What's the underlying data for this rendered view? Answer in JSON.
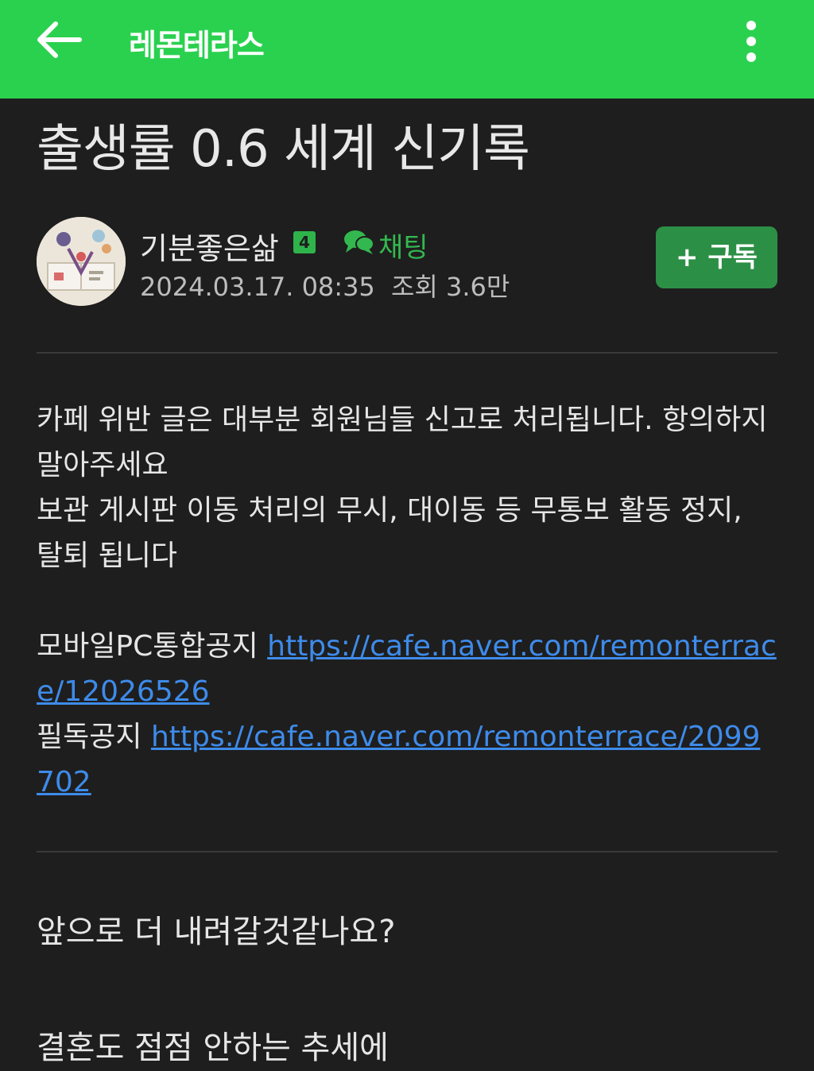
{
  "header": {
    "cafe_name": "레몬테라스",
    "back_icon": "arrow-left-icon",
    "more_icon": "more-vertical-icon",
    "bar_color": "#2ad14f"
  },
  "post": {
    "title": "출생률 0.6 세계 신기록",
    "author": {
      "name": "기분좋은삶",
      "level": "4",
      "chat_label": "채팅",
      "subscribe_label": "+ 구독"
    },
    "date": "2024.03.17. 08:35",
    "views": "조회 3.6만",
    "body": {
      "line1": "카페 위반 글은 대부분 회원님들 신고로 처리됩니다. 항의하지 말아주세요",
      "line2": "보관 게시판 이동 처리의 무시, 대이동 등 무통보 활동 정지, 탈퇴 됩니다",
      "notice1_label": "모바일PC통합공지",
      "notice1_url": "https://cafe.naver.com/remonterrace/12026526",
      "notice2_label": "필독공지",
      "notice2_url": "https://cafe.naver.com/remonterrace/2099702"
    },
    "content_line1": "앞으로 더 내려갈것같나요?",
    "content_line2": "결혼도 점점 안하는 추세에"
  },
  "colors": {
    "background": "#1e1e1e",
    "accent_green": "#2ad14f",
    "button_green": "#2c8f46",
    "link_blue": "#3e8bea"
  }
}
